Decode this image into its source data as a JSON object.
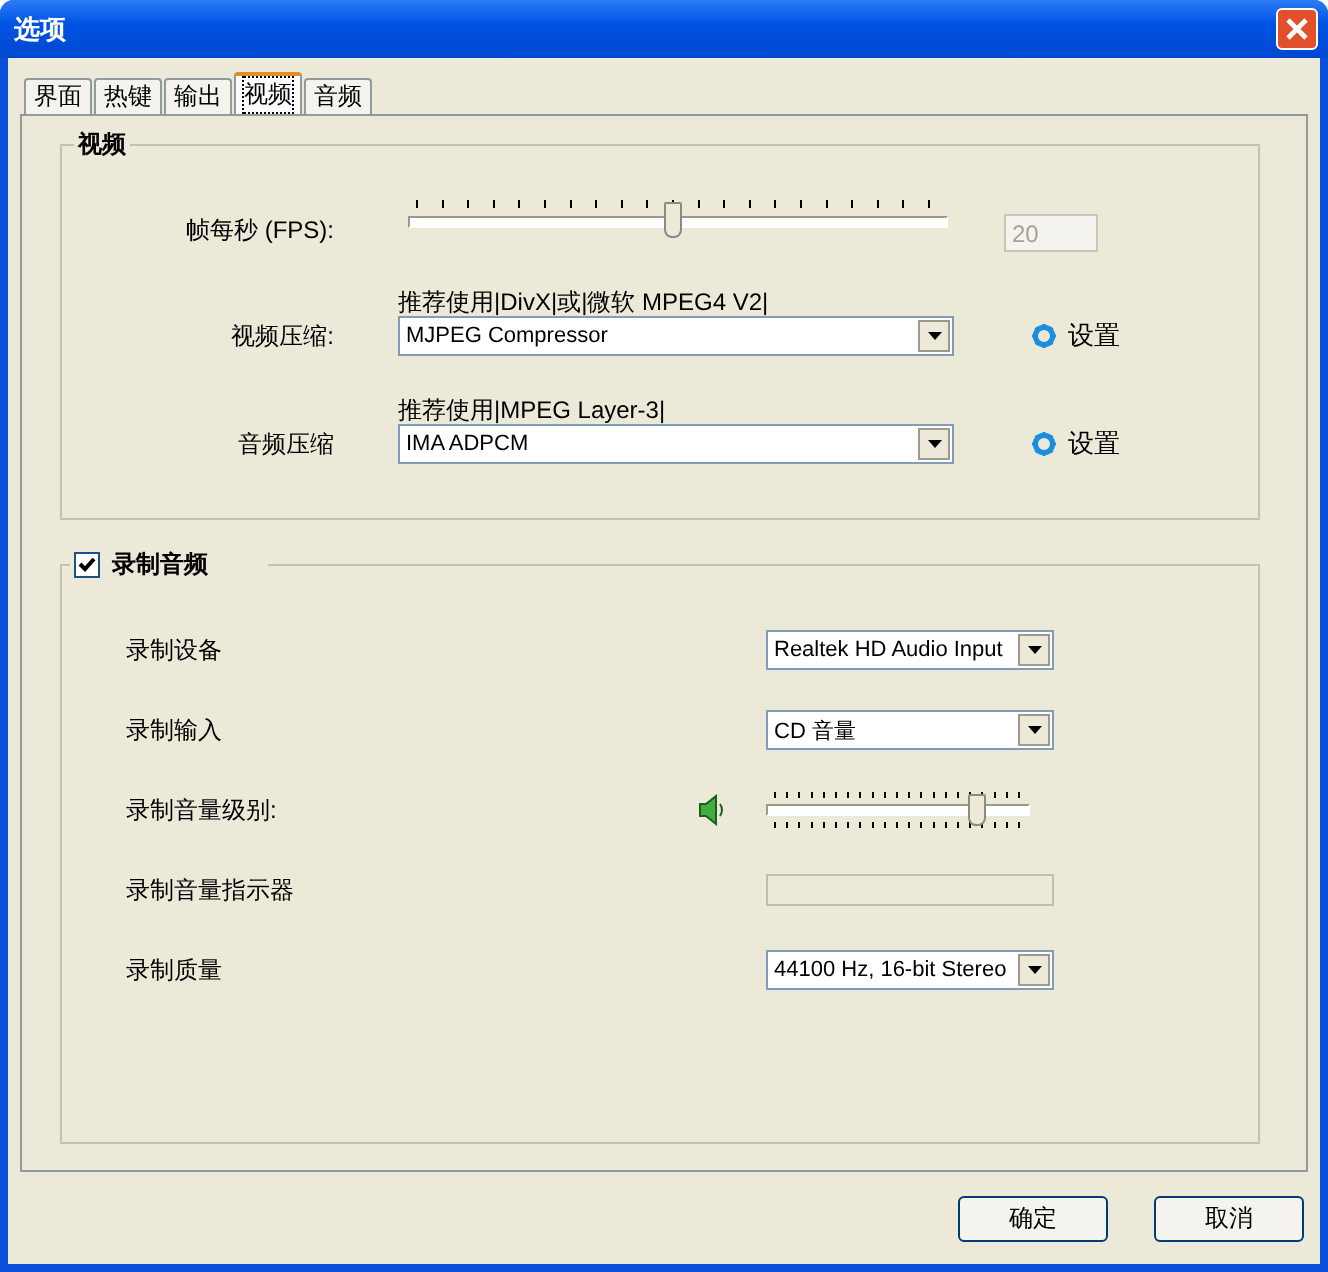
{
  "window": {
    "title": "选项"
  },
  "tabs": [
    {
      "label": "界面",
      "selected": false
    },
    {
      "label": "热键",
      "selected": false
    },
    {
      "label": "输出",
      "selected": false
    },
    {
      "label": "视频",
      "selected": true
    },
    {
      "label": "音频",
      "selected": false
    }
  ],
  "video_group": {
    "title": "视频",
    "fps": {
      "label": "帧每秒 (FPS):",
      "level": 0.49,
      "value": "20",
      "disabled": true
    },
    "compression": [
      {
        "hint": "推荐使用|DivX|或|微软 MPEG4 V2|",
        "label": "视频压缩:",
        "value": "MJPEG Compressor",
        "settings": "设置"
      },
      {
        "hint": "推荐使用|MPEG Layer-3|",
        "label": "音频压缩",
        "value": "IMA ADPCM",
        "settings": "设置"
      }
    ]
  },
  "record_group": {
    "title": "录制音频",
    "checked": true,
    "rows": [
      {
        "kind": "dropdown",
        "label": "录制设备",
        "value": "Realtek HD Audio Input"
      },
      {
        "kind": "dropdown",
        "label": "录制输入",
        "value": "CD 音量"
      },
      {
        "kind": "slider",
        "label": "录制音量级别:",
        "level": 0.8
      },
      {
        "kind": "meter",
        "label": "录制音量指示器",
        "level": 0
      },
      {
        "kind": "dropdown",
        "label": "录制质量",
        "value": "44100 Hz, 16-bit Stereo"
      }
    ]
  },
  "buttons": [
    "确定",
    "取消"
  ]
}
